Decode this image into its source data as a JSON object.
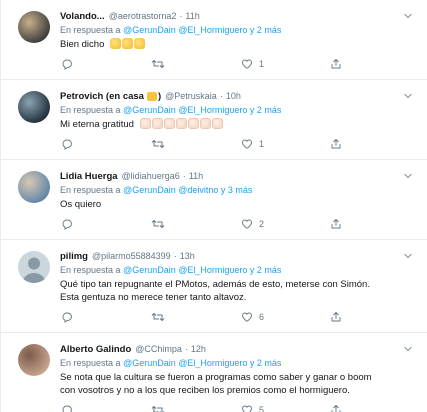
{
  "tweets": [
    {
      "name": "Volando...",
      "handle": "@aerotrastorna2",
      "time": "11h",
      "reply_prefix": "En respuesta a",
      "reply_to": "@GerunDain @El_Hormiguero y 2 más",
      "text": "Bien dicho",
      "emojis": [
        "clap",
        "clap",
        "clap"
      ],
      "reply_count": "",
      "retweet_count": "",
      "like_count": "1",
      "avatar_colors": [
        "#3b3b3b",
        "#c7b08a"
      ]
    },
    {
      "name": "Petrovich (en casa",
      "name_suffix": ")",
      "handle": "@Petruskaia",
      "time": "10h",
      "reply_prefix": "En respuesta a",
      "reply_to": "@GerunDain @El_Hormiguero y 2 más",
      "text": "Mi eterna gratitud",
      "emojis": [
        "clap-light",
        "clap-light",
        "clap-light",
        "clap-light",
        "clap-light",
        "clap-light",
        "clap-light"
      ],
      "reply_count": "",
      "retweet_count": "",
      "like_count": "1",
      "avatar_colors": [
        "#1f2e3a",
        "#8aa3b3"
      ]
    },
    {
      "name": "Lidia Huerga",
      "handle": "@lidiahuerga6",
      "time": "11h",
      "reply_prefix": "En respuesta a",
      "reply_to": "@GerunDain @deivitno y 3 más",
      "text": "Os quiero",
      "emojis": [],
      "reply_count": "",
      "retweet_count": "",
      "like_count": "2",
      "avatar_colors": [
        "#5f86a8",
        "#d9c8b3"
      ]
    },
    {
      "name": "pilimg",
      "handle": "@pilarmo55884399",
      "time": "13h",
      "reply_prefix": "En respuesta a",
      "reply_to": "@GerunDain @El_Hormiguero y 2 más",
      "text": "Qué tipo tan repugnante el PMotos, además de esto, meterse con Simón. Esta gentuza no merece tener tanto altavoz.",
      "emojis": [],
      "reply_count": "",
      "retweet_count": "",
      "like_count": "6",
      "avatar_colors": [
        "#ccd6dd",
        "#ccd6dd"
      ]
    },
    {
      "name": "Alberto Galindo",
      "handle": "@CChimpa",
      "time": "12h",
      "reply_prefix": "En respuesta a",
      "reply_to": "@GerunDain @El_Hormiguero y 2 más",
      "text": "Se nota que la cultura se fueron a programas como saber y ganar o boom con vosotros y no a los que reciben los premios como el hormiguero.",
      "emojis": [],
      "reply_count": "",
      "retweet_count": "",
      "like_count": "5",
      "avatar_colors": [
        "#c9a58f",
        "#7a5a4a"
      ]
    }
  ],
  "colors": {
    "link": "#1da1f2",
    "muted": "#657786",
    "border": "#e6ecf0",
    "text": "#14171a"
  }
}
